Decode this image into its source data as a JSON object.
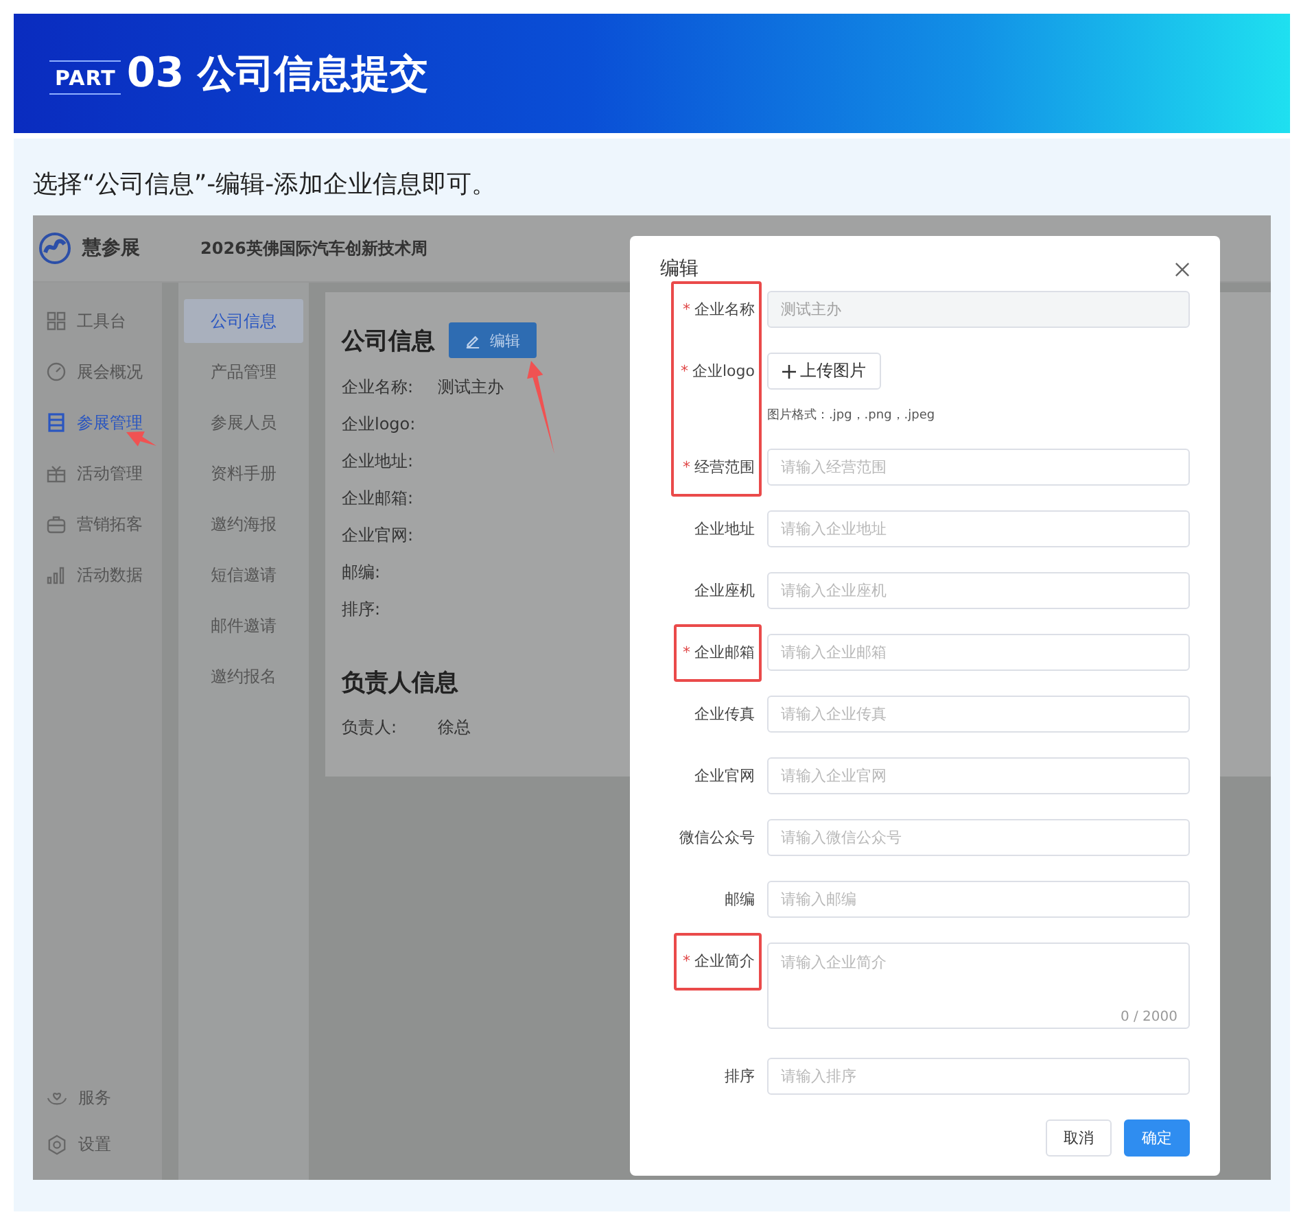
{
  "banner": {
    "part_label": "PART",
    "part_number": "03",
    "title": "公司信息提交"
  },
  "instruction": "选择“公司信息”-编辑-添加企业信息即可。",
  "app": {
    "brand": "慧参展",
    "event_title": "2026英佛国际汽车创新技术周",
    "sidebar": [
      {
        "label": "工具台",
        "selected": false,
        "pointed_at": false
      },
      {
        "label": "展会概况",
        "selected": false,
        "pointed_at": false
      },
      {
        "label": "参展管理",
        "selected": true,
        "pointed_at": true
      },
      {
        "label": "活动管理",
        "selected": false,
        "pointed_at": false
      },
      {
        "label": "营销拓客",
        "selected": false,
        "pointed_at": false
      },
      {
        "label": "活动数据",
        "selected": false,
        "pointed_at": false
      }
    ],
    "sidebar_bottom": [
      {
        "label": "服务"
      },
      {
        "label": "设置"
      }
    ],
    "submenu": [
      {
        "label": "公司信息",
        "selected": true
      },
      {
        "label": "产品管理",
        "selected": false
      },
      {
        "label": "参展人员",
        "selected": false
      },
      {
        "label": "资料手册",
        "selected": false
      },
      {
        "label": "邀约海报",
        "selected": false
      },
      {
        "label": "短信邀请",
        "selected": false
      },
      {
        "label": "邮件邀请",
        "selected": false
      },
      {
        "label": "邀约报名",
        "selected": false
      }
    ],
    "company_section": {
      "title": "公司信息",
      "edit_button": {
        "label": "编辑",
        "pointed_at": true
      },
      "fields": [
        {
          "label": "企业名称:",
          "value": "测试主办"
        },
        {
          "label": "企业logo:"
        },
        {
          "label": "企业地址:"
        },
        {
          "label": "企业邮箱:"
        },
        {
          "label": "企业官网:"
        },
        {
          "label": "邮编:"
        },
        {
          "label": "排序:"
        }
      ]
    },
    "contact_section": {
      "title": "负责人信息",
      "fields": [
        {
          "label": "负责人:",
          "value": "徐总"
        }
      ]
    }
  },
  "dialog": {
    "title": "编辑",
    "required_mark": "*",
    "fields": [
      {
        "kind": "input",
        "label": "企业名称",
        "required": true,
        "highlighted": true,
        "value": "测试主办",
        "disabled": true
      },
      {
        "kind": "upload",
        "label": "企业logo",
        "required": true,
        "highlighted": true,
        "button": "上传图片",
        "hint": "图片格式：.jpg，.png，.jpeg"
      },
      {
        "kind": "input",
        "label": "经营范围",
        "required": true,
        "highlighted": true,
        "placeholder": "请输入经营范围",
        "disabled": false
      },
      {
        "kind": "input",
        "label": "企业地址",
        "required": false,
        "highlighted": false,
        "placeholder": "请输入企业地址",
        "disabled": false
      },
      {
        "kind": "input",
        "label": "企业座机",
        "required": false,
        "highlighted": false,
        "placeholder": "请输入企业座机",
        "disabled": false
      },
      {
        "kind": "input",
        "label": "企业邮箱",
        "required": true,
        "highlighted": true,
        "placeholder": "请输入企业邮箱",
        "disabled": false
      },
      {
        "kind": "input",
        "label": "企业传真",
        "required": false,
        "highlighted": false,
        "placeholder": "请输入企业传真",
        "disabled": false
      },
      {
        "kind": "input",
        "label": "企业官网",
        "required": false,
        "highlighted": false,
        "placeholder": "请输入企业官网",
        "disabled": false
      },
      {
        "kind": "input",
        "label": "微信公众号",
        "required": false,
        "highlighted": false,
        "placeholder": "请输入微信公众号",
        "disabled": false
      },
      {
        "kind": "input",
        "label": "邮编",
        "required": false,
        "highlighted": false,
        "placeholder": "请输入邮编",
        "disabled": false
      },
      {
        "kind": "textarea",
        "label": "企业简介",
        "required": true,
        "highlighted": true,
        "placeholder": "请输入企业简介",
        "counter": "0 / 2000"
      },
      {
        "kind": "input",
        "label": "排序",
        "required": false,
        "highlighted": false,
        "placeholder": "请输入排序",
        "disabled": false
      }
    ],
    "buttons": [
      {
        "label": "取消",
        "primary": false
      },
      {
        "label": "确定",
        "primary": true
      }
    ]
  }
}
